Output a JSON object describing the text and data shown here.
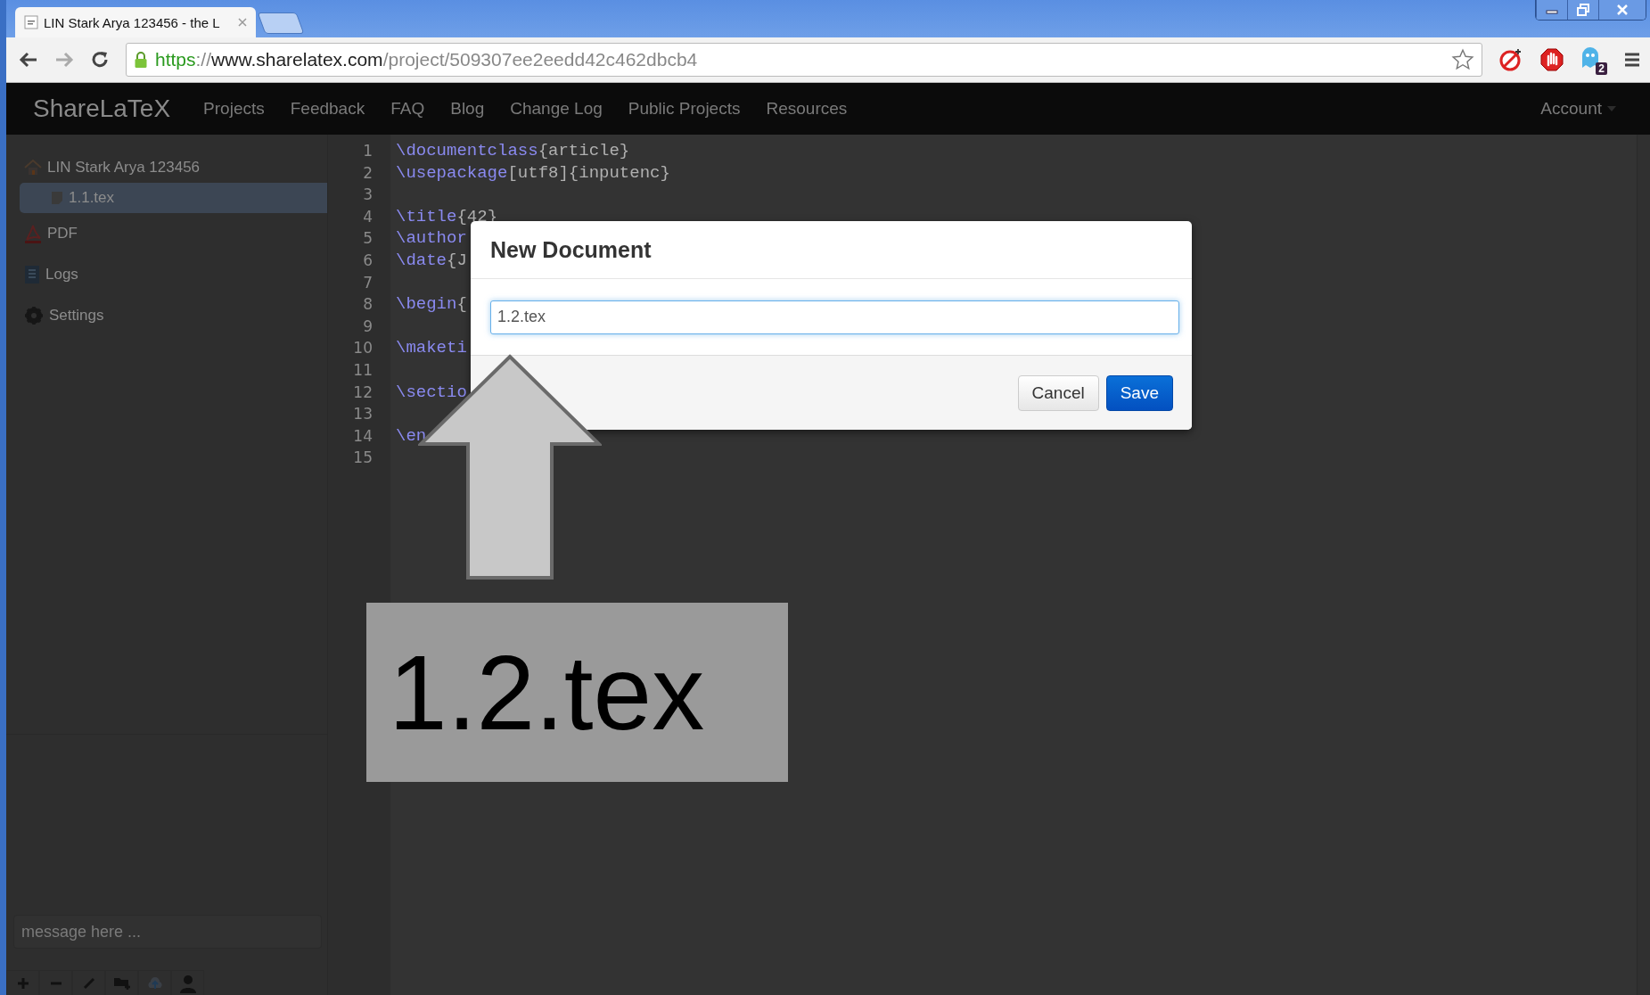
{
  "browser": {
    "tab": {
      "title": "LIN Stark Arya 123456 - the L"
    },
    "url": [
      {
        "kind": "scheme",
        "text": "https"
      },
      {
        "kind": "sep",
        "text": "://"
      },
      {
        "kind": "host",
        "text": "www.sharelatex.com"
      },
      {
        "kind": "path",
        "text": "/project/509307ee2eedd42c462dbcb4"
      }
    ],
    "extension_badge": "2"
  },
  "navbar": {
    "brand": "ShareLaTeX",
    "items": [
      "Projects",
      "Feedback",
      "FAQ",
      "Blog",
      "Change Log",
      "Public Projects",
      "Resources"
    ],
    "account": "Account"
  },
  "sidebar": {
    "project": {
      "name": "LIN Stark Arya 123456",
      "files": [
        {
          "name": "1.1.tex",
          "selected": true
        }
      ]
    },
    "items": [
      {
        "kind": "pdf",
        "label": "PDF"
      },
      {
        "kind": "logs",
        "label": "Logs"
      },
      {
        "kind": "settings",
        "label": "Settings"
      }
    ],
    "chat": {
      "placeholder": "message here ..."
    }
  },
  "editor": {
    "lines": [
      {
        "number": "1",
        "segments": [
          {
            "kind": "command",
            "text": "\\documentclass"
          },
          {
            "kind": "plain",
            "text": "{article}"
          }
        ]
      },
      {
        "number": "2",
        "segments": [
          {
            "kind": "command",
            "text": "\\usepackage"
          },
          {
            "kind": "plain",
            "text": "[utf8]{inputenc}"
          }
        ]
      },
      {
        "number": "3"
      },
      {
        "number": "4",
        "segments": [
          {
            "kind": "command",
            "text": "\\title"
          },
          {
            "kind": "plain",
            "text": "{42}"
          }
        ]
      },
      {
        "number": "5",
        "segments": [
          {
            "kind": "command",
            "text": "\\author"
          }
        ]
      },
      {
        "number": "6",
        "segments": [
          {
            "kind": "command",
            "text": "\\date"
          },
          {
            "kind": "plain",
            "text": "{J"
          }
        ]
      },
      {
        "number": "7"
      },
      {
        "number": "8",
        "segments": [
          {
            "kind": "command",
            "text": "\\begin"
          },
          {
            "kind": "plain",
            "text": "{"
          }
        ]
      },
      {
        "number": "9"
      },
      {
        "number": "10",
        "segments": [
          {
            "kind": "command",
            "text": "\\maketi"
          }
        ]
      },
      {
        "number": "11"
      },
      {
        "number": "12",
        "segments": [
          {
            "kind": "command",
            "text": "\\sectio"
          }
        ]
      },
      {
        "number": "13"
      },
      {
        "number": "14",
        "segments": [
          {
            "kind": "command",
            "text": "\\en"
          }
        ]
      },
      {
        "number": "15"
      }
    ]
  },
  "dialog": {
    "title": "New Document",
    "value": "1.2.tex",
    "buttons": [
      {
        "kind": "secondary",
        "label": "Cancel"
      },
      {
        "kind": "primary",
        "label": "Save"
      }
    ]
  },
  "annotation": {
    "label": "1.2.tex"
  }
}
